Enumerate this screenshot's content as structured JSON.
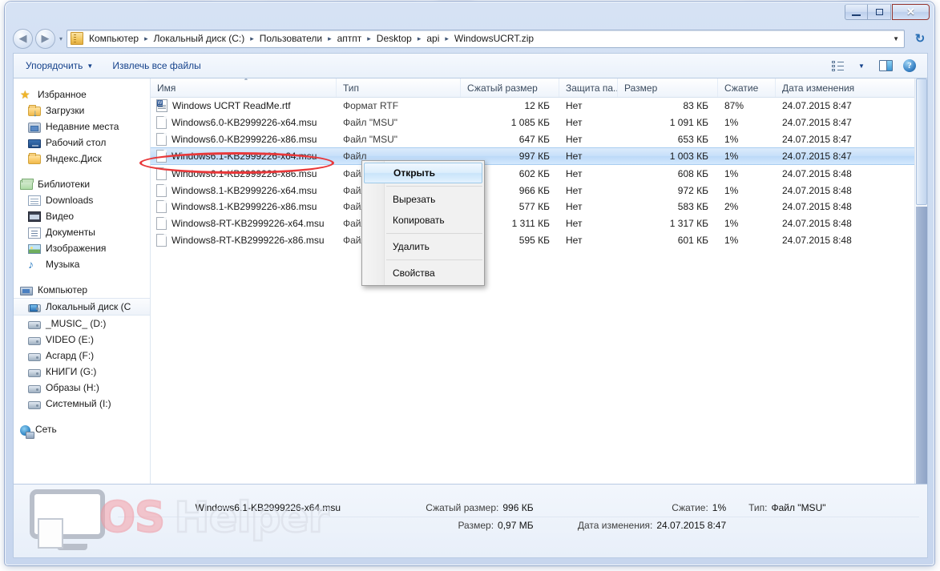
{
  "window": {
    "controls": {
      "minimize": "–",
      "maximize": "□",
      "close": "✕"
    }
  },
  "address": {
    "icon": "zip-folder-icon",
    "crumbs": [
      "Компьютер",
      "Локальный диск (C:)",
      "Пользователи",
      "аптпт",
      "Desktop",
      "api",
      "WindowsUCRT.zip"
    ],
    "separator": "▸",
    "dropdown_caret": "▼",
    "refresh_glyph": "↻",
    "back_glyph": "◀",
    "forward_glyph": "▶",
    "history_caret": "▾"
  },
  "toolbar": {
    "organize_label": "Упорядочить",
    "organize_caret": "▼",
    "extract_label": "Извлечь все файлы",
    "view_caret": "▼"
  },
  "nav_pane": {
    "groups": [
      {
        "header": {
          "label": "Избранное",
          "icon": "star-icon"
        },
        "items": [
          {
            "label": "Загрузки",
            "icon": "downloads-folder-icon"
          },
          {
            "label": "Недавние места",
            "icon": "recent-places-icon"
          },
          {
            "label": "Рабочий стол",
            "icon": "desktop-icon"
          },
          {
            "label": "Яндекс.Диск",
            "icon": "folder-icon"
          }
        ]
      },
      {
        "header": {
          "label": "Библиотеки",
          "icon": "libraries-icon"
        },
        "items": [
          {
            "label": "Downloads",
            "icon": "library-icon"
          },
          {
            "label": "Видео",
            "icon": "video-library-icon"
          },
          {
            "label": "Документы",
            "icon": "documents-library-icon"
          },
          {
            "label": "Изображения",
            "icon": "pictures-library-icon"
          },
          {
            "label": "Музыка",
            "icon": "music-library-icon"
          }
        ]
      },
      {
        "header": {
          "label": "Компьютер",
          "icon": "computer-icon"
        },
        "items": [
          {
            "label": "Локальный диск (C",
            "icon": "system-drive-icon",
            "selected": true
          },
          {
            "label": "_MUSIC_ (D:)",
            "icon": "drive-icon"
          },
          {
            "label": "VIDEO (E:)",
            "icon": "drive-icon"
          },
          {
            "label": "Асгард (F:)",
            "icon": "drive-icon"
          },
          {
            "label": "КНИГИ (G:)",
            "icon": "drive-icon"
          },
          {
            "label": "Образы (H:)",
            "icon": "drive-icon"
          },
          {
            "label": "Системный (I:)",
            "icon": "drive-icon"
          }
        ]
      },
      {
        "header": {
          "label": "Сеть",
          "icon": "network-icon"
        },
        "items": []
      }
    ]
  },
  "file_list": {
    "columns": [
      {
        "key": "name",
        "label": "Имя",
        "sorted": true
      },
      {
        "key": "type",
        "label": "Тип"
      },
      {
        "key": "csize",
        "label": "Сжатый размер"
      },
      {
        "key": "prot",
        "label": "Защита па..."
      },
      {
        "key": "size",
        "label": "Размер"
      },
      {
        "key": "ratio",
        "label": "Сжатие"
      },
      {
        "key": "date",
        "label": "Дата изменения"
      }
    ],
    "rows": [
      {
        "icon": "rtf-file-icon",
        "name": "Windows UCRT ReadMe.rtf",
        "type": "Формат RTF",
        "csize": "12 КБ",
        "prot": "Нет",
        "size": "83 КБ",
        "ratio": "87%",
        "date": "24.07.2015 8:47",
        "selected": false
      },
      {
        "icon": "msu-file-icon",
        "name": "Windows6.0-KB2999226-x64.msu",
        "type": "Файл \"MSU\"",
        "csize": "1 085 КБ",
        "prot": "Нет",
        "size": "1 091 КБ",
        "ratio": "1%",
        "date": "24.07.2015 8:47",
        "selected": false
      },
      {
        "icon": "msu-file-icon",
        "name": "Windows6.0-KB2999226-x86.msu",
        "type": "Файл \"MSU\"",
        "csize": "647 КБ",
        "prot": "Нет",
        "size": "653 КБ",
        "ratio": "1%",
        "date": "24.07.2015 8:47",
        "selected": false
      },
      {
        "icon": "msu-file-icon",
        "name": "Windows6.1-KB2999226-x64.msu",
        "type": "Файл",
        "csize": "997 КБ",
        "prot": "Нет",
        "size": "1 003 КБ",
        "ratio": "1%",
        "date": "24.07.2015 8:47",
        "selected": true
      },
      {
        "icon": "msu-file-icon",
        "name": "Windows6.1-KB2999226-x86.msu",
        "type": "Файл",
        "csize": "602 КБ",
        "prot": "Нет",
        "size": "608 КБ",
        "ratio": "1%",
        "date": "24.07.2015 8:48",
        "selected": false
      },
      {
        "icon": "msu-file-icon",
        "name": "Windows8.1-KB2999226-x64.msu",
        "type": "Файл",
        "csize": "966 КБ",
        "prot": "Нет",
        "size": "972 КБ",
        "ratio": "1%",
        "date": "24.07.2015 8:48",
        "selected": false
      },
      {
        "icon": "msu-file-icon",
        "name": "Windows8.1-KB2999226-x86.msu",
        "type": "Файл",
        "csize": "577 КБ",
        "prot": "Нет",
        "size": "583 КБ",
        "ratio": "2%",
        "date": "24.07.2015 8:48",
        "selected": false
      },
      {
        "icon": "msu-file-icon",
        "name": "Windows8-RT-KB2999226-x64.msu",
        "type": "Файл",
        "csize": "1 311 КБ",
        "prot": "Нет",
        "size": "1 317 КБ",
        "ratio": "1%",
        "date": "24.07.2015 8:48",
        "selected": false
      },
      {
        "icon": "msu-file-icon",
        "name": "Windows8-RT-KB2999226-x86.msu",
        "type": "Файл",
        "csize": "595 КБ",
        "prot": "Нет",
        "size": "601 КБ",
        "ratio": "1%",
        "date": "24.07.2015 8:48",
        "selected": false
      }
    ]
  },
  "context_menu": {
    "items": [
      {
        "label": "Открыть",
        "bold": true,
        "highlighted": true
      },
      {
        "separator": true
      },
      {
        "label": "Вырезать",
        "bold": false,
        "highlighted": false
      },
      {
        "label": "Копировать",
        "bold": false,
        "highlighted": false
      },
      {
        "separator": true
      },
      {
        "label": "Удалить",
        "bold": false,
        "highlighted": false
      },
      {
        "separator": true
      },
      {
        "label": "Свойства",
        "bold": false,
        "highlighted": false
      }
    ]
  },
  "status_bar": {
    "filename": "Windows6.1-KB2999226-x64.msu",
    "compressed_size_label": "Сжатый размер:",
    "compressed_size_value": "996 КБ",
    "size_label": "Размер:",
    "size_value": "0,97 МБ",
    "ratio_label": "Сжатие:",
    "ratio_value": "1%",
    "date_label": "Дата изменения:",
    "date_value": "24.07.2015 8:47",
    "type_label": "Тип:",
    "type_value": "Файл \"MSU\""
  },
  "watermark": {
    "part1": "OS",
    "part2": "Helper"
  },
  "annotation": {
    "shape": "ellipse",
    "color": "#e8383a",
    "target": "Windows6.1-KB2999226-x64.msu"
  }
}
